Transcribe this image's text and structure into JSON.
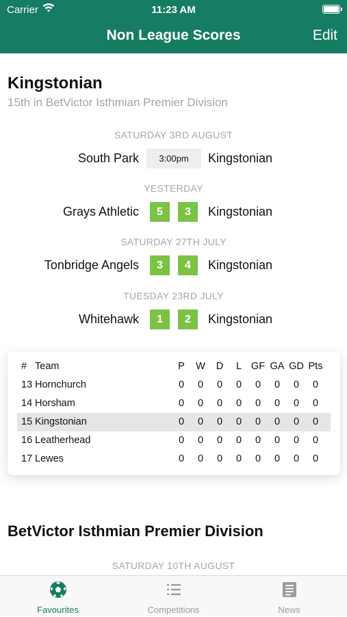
{
  "status_bar": {
    "carrier": "Carrier",
    "time": "11:23 AM"
  },
  "nav": {
    "title": "Non League Scores",
    "edit_label": "Edit"
  },
  "team": {
    "name": "Kingstonian",
    "position_text": "15th in BetVictor Isthmian Premier Division"
  },
  "fixtures": [
    {
      "date": "SATURDAY 3RD AUGUST",
      "home": "South Park",
      "away": "Kingstonian",
      "kickoff": "3:00pm"
    },
    {
      "date": "YESTERDAY",
      "home": "Grays Athletic",
      "away": "Kingstonian",
      "home_score": "5",
      "away_score": "3"
    },
    {
      "date": "SATURDAY 27TH JULY",
      "home": "Tonbridge Angels",
      "away": "Kingstonian",
      "home_score": "3",
      "away_score": "4"
    },
    {
      "date": "TUESDAY 23RD JULY",
      "home": "Whitehawk",
      "away": "Kingstonian",
      "home_score": "1",
      "away_score": "2"
    }
  ],
  "league_table": {
    "headers": {
      "pos": "#",
      "team": "Team",
      "p": "P",
      "w": "W",
      "d": "D",
      "l": "L",
      "gf": "GF",
      "ga": "GA",
      "gd": "GD",
      "pts": "Pts"
    },
    "rows": [
      {
        "pos": "13",
        "team": "Hornchurch",
        "p": "0",
        "w": "0",
        "d": "0",
        "l": "0",
        "gf": "0",
        "ga": "0",
        "gd": "0",
        "pts": "0"
      },
      {
        "pos": "14",
        "team": "Horsham",
        "p": "0",
        "w": "0",
        "d": "0",
        "l": "0",
        "gf": "0",
        "ga": "0",
        "gd": "0",
        "pts": "0"
      },
      {
        "pos": "15",
        "team": "Kingstonian",
        "p": "0",
        "w": "0",
        "d": "0",
        "l": "0",
        "gf": "0",
        "ga": "0",
        "gd": "0",
        "pts": "0"
      },
      {
        "pos": "16",
        "team": "Leatherhead",
        "p": "0",
        "w": "0",
        "d": "0",
        "l": "0",
        "gf": "0",
        "ga": "0",
        "gd": "0",
        "pts": "0"
      },
      {
        "pos": "17",
        "team": "Lewes",
        "p": "0",
        "w": "0",
        "d": "0",
        "l": "0",
        "gf": "0",
        "ga": "0",
        "gd": "0",
        "pts": "0"
      }
    ]
  },
  "league_section": {
    "title": "BetVictor Isthmian Premier Division",
    "next_date": "SATURDAY 10TH AUGUST"
  },
  "tabs": [
    {
      "label": "Favourites",
      "icon": "football-icon",
      "active": true
    },
    {
      "label": "Competitions",
      "icon": "list-icon",
      "active": false
    },
    {
      "label": "News",
      "icon": "newspaper-icon",
      "active": false
    }
  ],
  "colors": {
    "brand_green": "#167c62",
    "score_green": "#7cc244",
    "highlight_row": "#e5e5e8"
  }
}
